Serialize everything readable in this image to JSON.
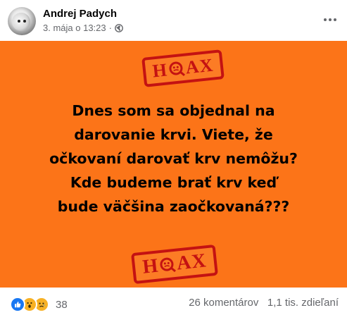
{
  "post": {
    "author": "Andrej Padych",
    "timestamp": "3. mája o 13:23",
    "separator": "·",
    "privacy_icon": "globe-icon",
    "menu_icon": "more-options-icon"
  },
  "image": {
    "stamp_text": "HOAX",
    "stamp_left": "H",
    "stamp_right": "AX",
    "headline_lines": [
      "Dnes som sa objednal na",
      "darovanie krvi. Viete, že",
      "očkovaní darovať krv nemôžu?",
      "Kde budeme brať krv keď",
      "bude väčšina zaočkovaná???"
    ],
    "colors": {
      "background": "#fc7418",
      "stamp": "#c41212",
      "text": "#000000"
    }
  },
  "footer": {
    "reactions": [
      "like",
      "wow",
      "sad"
    ],
    "reaction_count": "38",
    "comments": "26 komentárov",
    "shares": "1,1 tis. zdieľaní"
  }
}
